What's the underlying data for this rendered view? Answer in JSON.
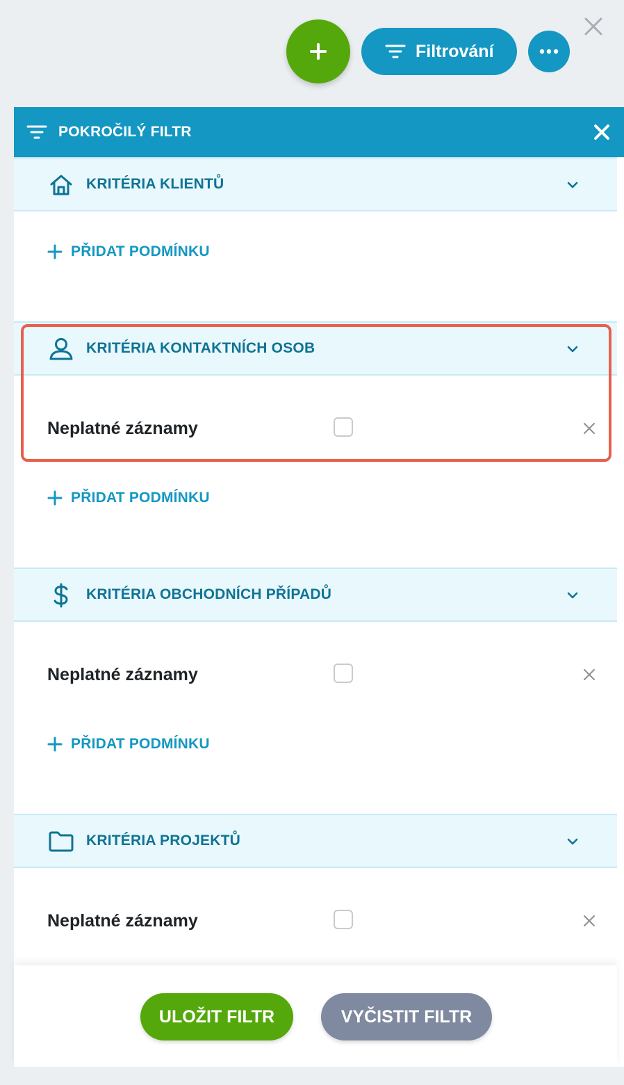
{
  "toolbar": {
    "add_icon": "plus-icon",
    "filter_label": "Filtrování",
    "filter_icon": "filter-lines-icon",
    "more_icon": "more-dots-icon",
    "close_icon": "close-icon"
  },
  "panel": {
    "title": "POKROČILÝ FILTR",
    "title_icon": "filter-lines-icon",
    "close_icon": "close-icon"
  },
  "sections": [
    {
      "title": "KRITÉRIA KLIENTŮ",
      "icon": "home-icon",
      "conditions": [],
      "add_label": "PŘIDAT PODMÍNKU"
    },
    {
      "title": "KRITÉRIA KONTAKTNÍCH OSOB",
      "icon": "person-icon",
      "conditions": [
        {
          "label": "Neplatné záznamy",
          "checked": false
        }
      ],
      "add_label": "PŘIDAT PODMÍNKU",
      "highlighted": true
    },
    {
      "title": "KRITÉRIA OBCHODNÍCH PŘÍPADŮ",
      "icon": "dollar-icon",
      "conditions": [
        {
          "label": "Neplatné záznamy",
          "checked": false
        }
      ],
      "add_label": "PŘIDAT PODMÍNKU"
    },
    {
      "title": "KRITÉRIA PROJEKTŮ",
      "icon": "folder-icon",
      "conditions": [
        {
          "label": "Neplatné záznamy",
          "checked": false
        }
      ]
    }
  ],
  "footer": {
    "save_label": "ULOŽIT FILTR",
    "clear_label": "VYČISTIT FILTR"
  },
  "colors": {
    "accent": "#1497c2",
    "success": "#55a80b",
    "neutral": "#7f8aa1",
    "section_bg": "#e9f8fd",
    "section_text": "#0f7394",
    "highlight": "#e8604c"
  }
}
